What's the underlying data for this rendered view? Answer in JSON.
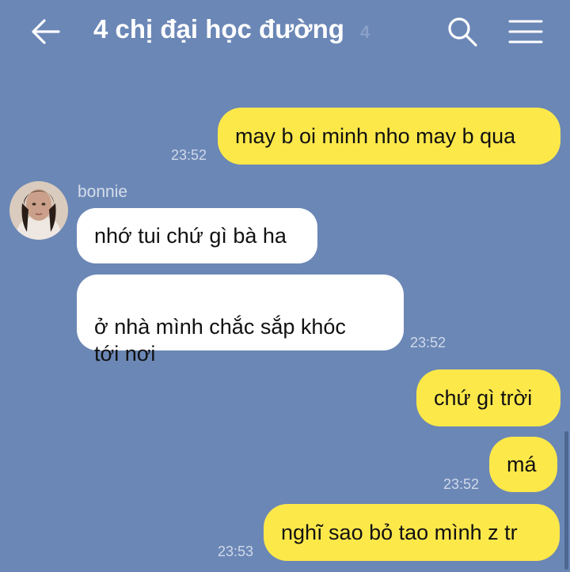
{
  "header": {
    "title": "4 chị đại học đường",
    "member_count": "4",
    "icons": {
      "back": "arrow-left-icon",
      "search": "search-icon",
      "menu": "hamburger-menu-icon"
    }
  },
  "messages": [
    {
      "direction": "outgoing",
      "text": "may b oi minh nho may b qua",
      "time": "23:52"
    },
    {
      "direction": "incoming",
      "sender": "bonnie",
      "text": "nhớ tui chứ gì bà ha",
      "time": ""
    },
    {
      "direction": "incoming",
      "sender": "bonnie",
      "text": "ở nhà mình chắc sắp khóc\ntới nơi",
      "time": "23:52"
    },
    {
      "direction": "outgoing",
      "text": "chứ gì trời",
      "time": ""
    },
    {
      "direction": "outgoing",
      "text": "má",
      "time": "23:52"
    },
    {
      "direction": "outgoing",
      "text": "nghĩ sao bỏ tao mình z tr",
      "time": "23:53"
    }
  ],
  "colors": {
    "background": "#6b87b6",
    "outgoing_bubble": "#fde84a",
    "incoming_bubble": "#ffffff"
  }
}
